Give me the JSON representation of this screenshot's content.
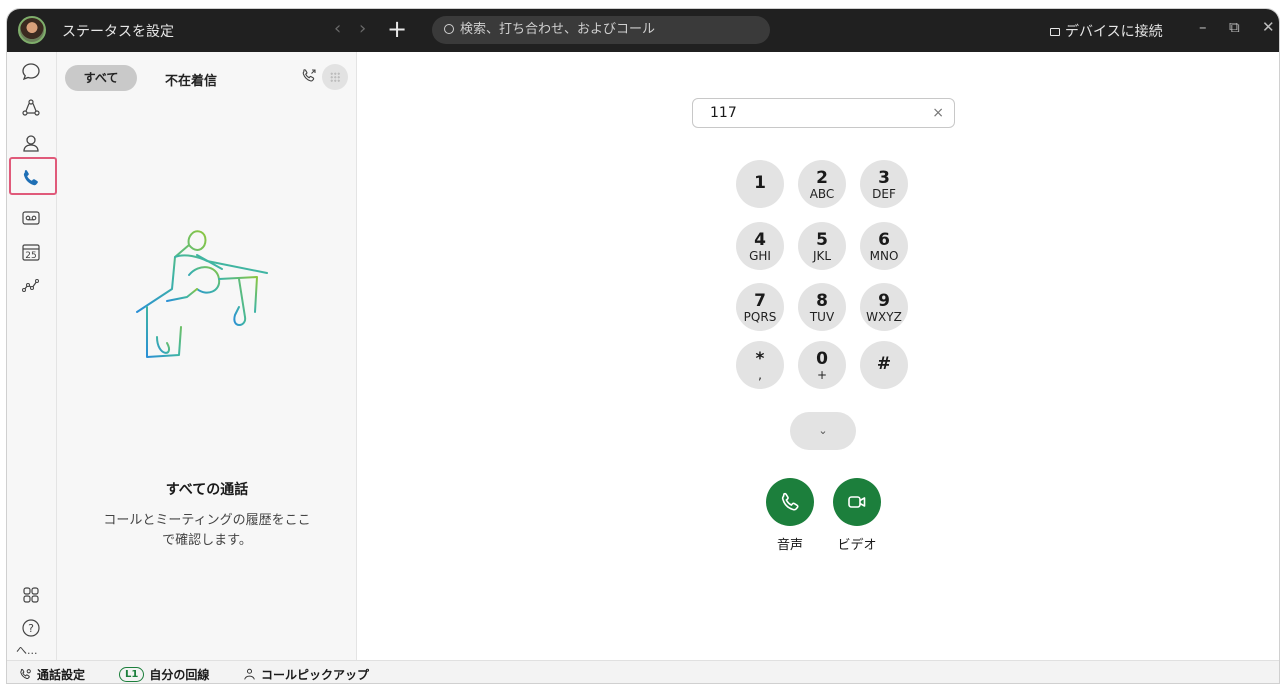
{
  "titlebar": {
    "status": "ステータスを設定",
    "back": "‹",
    "forward": "›",
    "new": "+",
    "search_placeholder": "検索、打ち合わせ、およびコール",
    "connect": "デバイスに接続",
    "minimize": "–",
    "maximize": "⧉",
    "close": "✕"
  },
  "rail": {
    "items": [
      "messaging-icon",
      "teams-icon",
      "contacts-icon",
      "calling-icon",
      "voicemail-icon",
      "calendar-icon",
      "analytics-icon"
    ],
    "calendar_day": "25",
    "bottom": [
      "apps-icon",
      "help-icon"
    ],
    "more": "へ..."
  },
  "history": {
    "tab_all": "すべて",
    "tab_missed": "不在着信",
    "empty_title": "すべての通話",
    "empty_desc": "コールとミーティングの履歴をここで確認します。"
  },
  "dialer": {
    "input_value": "117",
    "clear": "×",
    "keys": [
      {
        "digit": "1",
        "letters": ""
      },
      {
        "digit": "2",
        "letters": "ABC"
      },
      {
        "digit": "3",
        "letters": "DEF"
      },
      {
        "digit": "4",
        "letters": "GHI"
      },
      {
        "digit": "5",
        "letters": "JKL"
      },
      {
        "digit": "6",
        "letters": "MNO"
      },
      {
        "digit": "7",
        "letters": "PQRS"
      },
      {
        "digit": "8",
        "letters": "TUV"
      },
      {
        "digit": "9",
        "letters": "WXYZ"
      },
      {
        "digit": "*",
        "letters": ","
      },
      {
        "digit": "0",
        "letters": "+"
      },
      {
        "digit": "#",
        "letters": ""
      }
    ],
    "more_chevron": "⌄",
    "audio_label": "音声",
    "video_label": "ビデオ"
  },
  "statusbar": {
    "call_settings": "通話設定",
    "line_badge": "L1",
    "my_line": "自分の回線",
    "pickup": "コールピックアップ"
  },
  "colors": {
    "accent_green": "#1c7f3c",
    "highlight": "#e05a7a"
  }
}
